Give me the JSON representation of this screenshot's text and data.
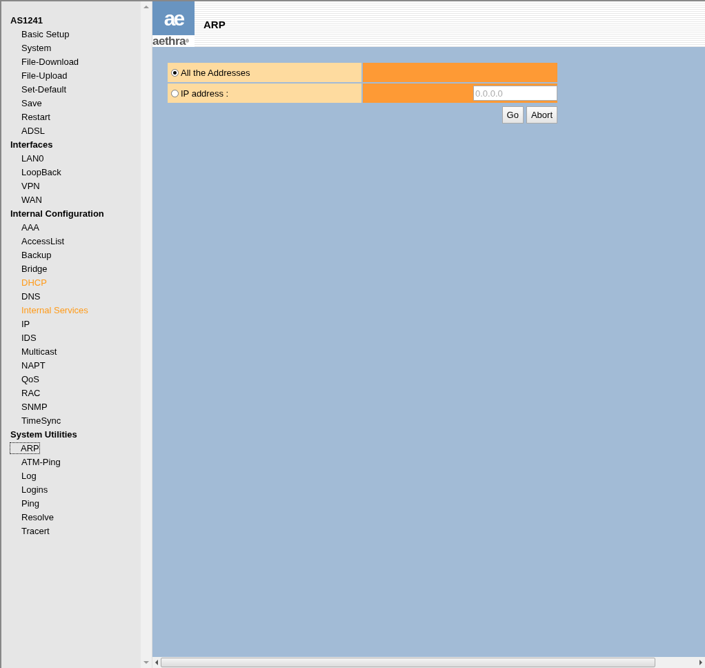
{
  "menu": [
    {
      "label": "AS1241",
      "kind": "group",
      "highlighted": false,
      "focused": false
    },
    {
      "label": "Basic Setup",
      "kind": "link",
      "highlighted": false,
      "focused": false
    },
    {
      "label": "System",
      "kind": "link",
      "highlighted": false,
      "focused": false
    },
    {
      "label": "File-Download",
      "kind": "link",
      "highlighted": false,
      "focused": false
    },
    {
      "label": "File-Upload",
      "kind": "link",
      "highlighted": false,
      "focused": false
    },
    {
      "label": "Set-Default",
      "kind": "link",
      "highlighted": false,
      "focused": false
    },
    {
      "label": "Save",
      "kind": "link",
      "highlighted": false,
      "focused": false
    },
    {
      "label": "Restart",
      "kind": "link",
      "highlighted": false,
      "focused": false
    },
    {
      "label": "ADSL",
      "kind": "link",
      "highlighted": false,
      "focused": false
    },
    {
      "label": "Interfaces",
      "kind": "group",
      "highlighted": false,
      "focused": false
    },
    {
      "label": "LAN0",
      "kind": "link",
      "highlighted": false,
      "focused": false
    },
    {
      "label": "LoopBack",
      "kind": "link",
      "highlighted": false,
      "focused": false
    },
    {
      "label": "VPN",
      "kind": "link",
      "highlighted": false,
      "focused": false
    },
    {
      "label": "WAN",
      "kind": "link",
      "highlighted": false,
      "focused": false
    },
    {
      "label": "Internal Configuration",
      "kind": "group",
      "highlighted": false,
      "focused": false
    },
    {
      "label": "AAA",
      "kind": "link",
      "highlighted": false,
      "focused": false
    },
    {
      "label": "AccessList",
      "kind": "link",
      "highlighted": false,
      "focused": false
    },
    {
      "label": "Backup",
      "kind": "link",
      "highlighted": false,
      "focused": false
    },
    {
      "label": "Bridge",
      "kind": "link",
      "highlighted": false,
      "focused": false
    },
    {
      "label": "DHCP",
      "kind": "link",
      "highlighted": true,
      "focused": false
    },
    {
      "label": "DNS",
      "kind": "link",
      "highlighted": false,
      "focused": false
    },
    {
      "label": "Internal Services",
      "kind": "link",
      "highlighted": true,
      "focused": false
    },
    {
      "label": "IP",
      "kind": "link",
      "highlighted": false,
      "focused": false
    },
    {
      "label": "IDS",
      "kind": "link",
      "highlighted": false,
      "focused": false
    },
    {
      "label": "Multicast",
      "kind": "link",
      "highlighted": false,
      "focused": false
    },
    {
      "label": "NAPT",
      "kind": "link",
      "highlighted": false,
      "focused": false
    },
    {
      "label": "QoS",
      "kind": "link",
      "highlighted": false,
      "focused": false
    },
    {
      "label": "RAC",
      "kind": "link",
      "highlighted": false,
      "focused": false
    },
    {
      "label": "SNMP",
      "kind": "link",
      "highlighted": false,
      "focused": false
    },
    {
      "label": "TimeSync",
      "kind": "link",
      "highlighted": false,
      "focused": false
    },
    {
      "label": "System Utilities",
      "kind": "group",
      "highlighted": false,
      "focused": false
    },
    {
      "label": "ARP",
      "kind": "link",
      "highlighted": false,
      "focused": true
    },
    {
      "label": "ATM-Ping",
      "kind": "link",
      "highlighted": false,
      "focused": false
    },
    {
      "label": "Log",
      "kind": "link",
      "highlighted": false,
      "focused": false
    },
    {
      "label": "Logins",
      "kind": "link",
      "highlighted": false,
      "focused": false
    },
    {
      "label": "Ping",
      "kind": "link",
      "highlighted": false,
      "focused": false
    },
    {
      "label": "Resolve",
      "kind": "link",
      "highlighted": false,
      "focused": false
    },
    {
      "label": "Tracert",
      "kind": "link",
      "highlighted": false,
      "focused": false
    }
  ],
  "logo": {
    "mark": "ae",
    "wordmark": "aethra",
    "registered": "®"
  },
  "page_title": "ARP",
  "options": [
    {
      "label": "All the Addresses",
      "selected": true
    },
    {
      "label": "IP address :",
      "selected": false,
      "placeholder": "0.0.0.0"
    }
  ],
  "buttons": [
    "Go",
    "Abort"
  ]
}
